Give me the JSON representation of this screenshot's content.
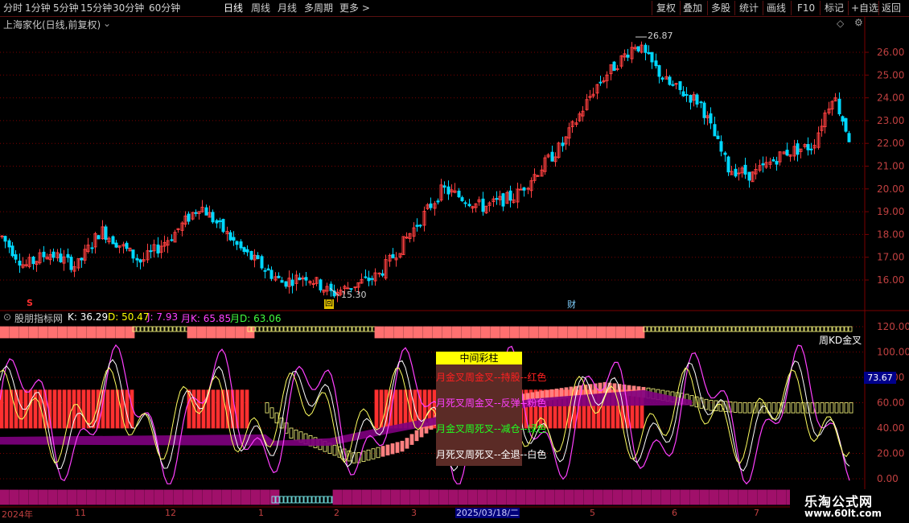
{
  "toolbar": {
    "left_items": [
      "分时",
      "1分钟",
      "5分钟",
      "15分钟",
      "30分钟",
      "60分钟",
      "日线",
      "周线",
      "月线",
      "多周期",
      "更多 >"
    ],
    "active": "日线",
    "right_items": [
      "复权",
      "叠加",
      "多股",
      "统计",
      "画线",
      "F10",
      "标记",
      "+自选",
      "返回"
    ]
  },
  "main_chart": {
    "title": "上海家化(日线,前复权)",
    "y_ticks": [
      "26.00",
      "25.00",
      "24.00",
      "23.00",
      "22.00",
      "21.00",
      "20.00",
      "19.00",
      "18.00",
      "17.00",
      "16.00"
    ],
    "high_label": "26.87",
    "low_label": "15.30",
    "marker_s": "S",
    "marker_hui": "回",
    "marker_cai": "财"
  },
  "indicator": {
    "name": "股朋指标网",
    "k_label": "K: 36.29",
    "d_label": "D: 50.47",
    "j_label": "J: 7.93",
    "mk_label": "月K: 65.85",
    "md_label": "月D: 63.06",
    "y_ticks": [
      "120.00",
      "100.00",
      "80.00",
      "60.00",
      "40.00",
      "20.00",
      "0.00"
    ],
    "week_kd_label": "周KD金叉",
    "price_tag": "73.67"
  },
  "legend": {
    "title": "中间彩柱",
    "lines": [
      "月金叉周金叉--持股--红色",
      "月死叉周金叉--反弹--粉色",
      "月金叉周死叉--减仓--绿色",
      "月死叉周死叉--全退--白色"
    ],
    "colors": [
      "#ff2020",
      "#ff40ff",
      "#20ff20",
      "#ffffff"
    ]
  },
  "date_axis": {
    "labels": [
      "2024年",
      "11",
      "12",
      "1",
      "2",
      "3",
      "5",
      "6",
      "7"
    ],
    "cursor_date": "2025/03/18/二"
  },
  "watermark": {
    "title": "乐淘公式网",
    "url": "www.60lt.com"
  },
  "colors": {
    "up": "#ff4040",
    "down": "#00d8ff",
    "grid": "#7a0000"
  }
}
